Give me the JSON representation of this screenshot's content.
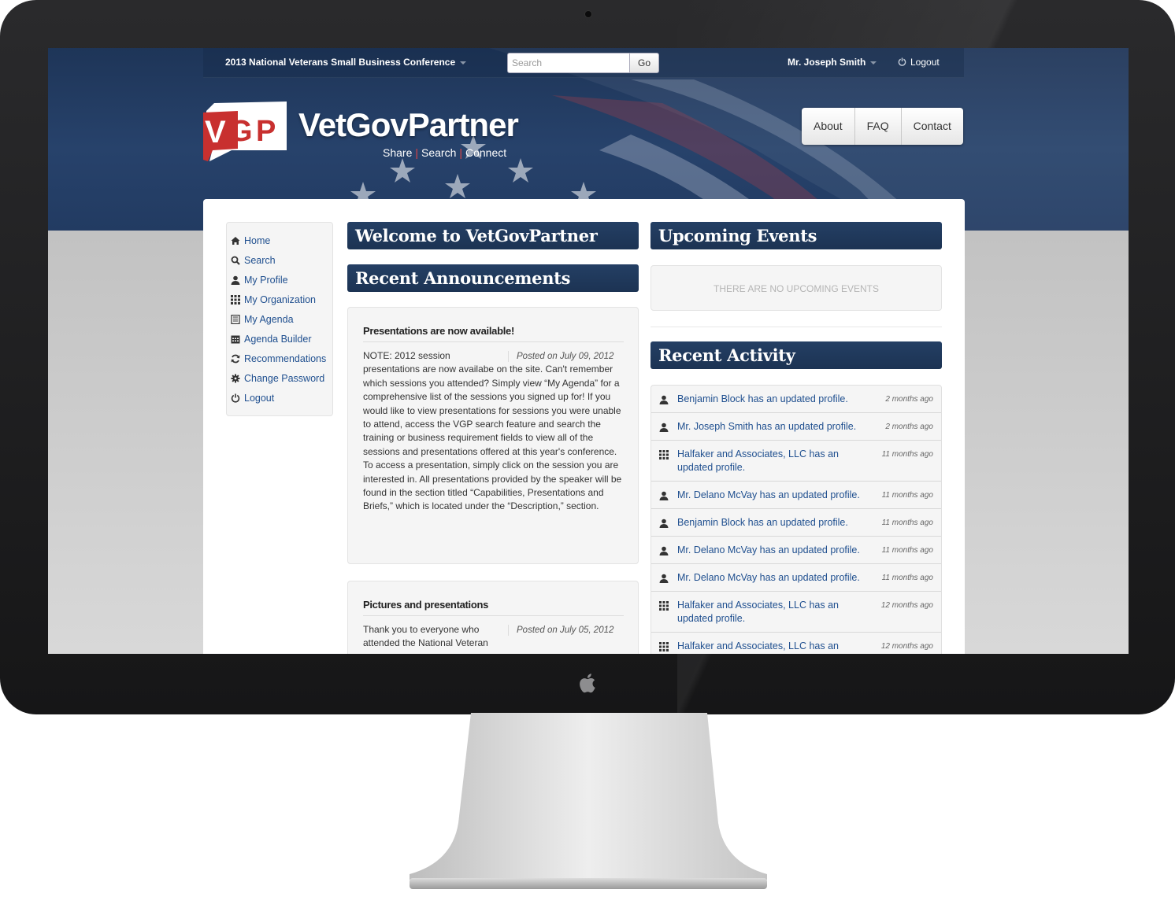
{
  "topbar": {
    "conference": "2013 National Veterans Small Business Conference",
    "search_placeholder": "Search",
    "go_label": "Go",
    "user": "Mr. Joseph Smith",
    "logout": "Logout"
  },
  "brand": {
    "name": "VetGovPartner",
    "tagline": [
      "Share",
      "Search",
      "Connect"
    ]
  },
  "nav": [
    "About",
    "FAQ",
    "Contact"
  ],
  "sidebar": {
    "items": [
      {
        "label": "Home",
        "icon": "home-icon"
      },
      {
        "label": "Search",
        "icon": "search-icon"
      },
      {
        "label": "My Profile",
        "icon": "user-icon"
      },
      {
        "label": "My Organization",
        "icon": "grid-icon"
      },
      {
        "label": "My Agenda",
        "icon": "list-icon"
      },
      {
        "label": "Agenda Builder",
        "icon": "calendar-icon"
      },
      {
        "label": "Recommendations",
        "icon": "refresh-icon"
      },
      {
        "label": "Change Password",
        "icon": "gear-icon"
      },
      {
        "label": "Logout",
        "icon": "power-icon"
      }
    ]
  },
  "headings": {
    "welcome": "Welcome to VetGovPartner",
    "announcements": "Recent Announcements",
    "events": "Upcoming Events",
    "activity": "Recent Activity"
  },
  "announcements": [
    {
      "title": "Presentations are now available!",
      "posted": "Posted on July 09, 2012",
      "body": "NOTE:  2012 session presentations are now availabe on the site.  Can't remember which sessions you attended? Simply view “My Agenda” for a comprehensive list of the sessions you signed up for!  If you would like to view presentations for sessions you were unable to attend, access the VGP search feature and search the training or business requirement fields to view all of the sessions and presentations offered at this year's conference.  To access a presentation, simply click on the session you are interested in. All presentations provided by the speaker will be found in the section titled “Capabilities, Presentations and Briefs,” which is located under the “Description,” section."
    },
    {
      "title": "Pictures and presentations",
      "posted": "Posted on July 05, 2012",
      "body": "Thank you to everyone who attended the National Veteran"
    }
  ],
  "events": {
    "empty_text": "There are no upcoming events"
  },
  "activity": [
    {
      "icon": "user-icon",
      "text": "Benjamin Block has an updated profile.",
      "time": "2 months ago"
    },
    {
      "icon": "user-icon",
      "text": "Mr. Joseph Smith has an updated profile.",
      "time": "2 months ago"
    },
    {
      "icon": "grid-icon",
      "text": "Halfaker and Associates, LLC has an updated profile.",
      "time": "11 months ago"
    },
    {
      "icon": "user-icon",
      "text": "Mr. Delano McVay has an updated profile.",
      "time": "11 months ago"
    },
    {
      "icon": "user-icon",
      "text": "Benjamin Block has an updated profile.",
      "time": "11 months ago"
    },
    {
      "icon": "user-icon",
      "text": "Mr. Delano McVay has an updated profile.",
      "time": "11 months ago"
    },
    {
      "icon": "user-icon",
      "text": "Mr. Delano McVay has an updated profile.",
      "time": "11 months ago"
    },
    {
      "icon": "grid-icon",
      "text": "Halfaker and Associates, LLC has an updated profile.",
      "time": "12 months ago"
    },
    {
      "icon": "grid-icon",
      "text": "Halfaker and Associates, LLC has an updated profile.",
      "time": "12 months ago"
    }
  ],
  "colors": {
    "header_blue": "#243f64",
    "link_blue": "#1f4f8f",
    "logo_red": "#c8302f"
  }
}
